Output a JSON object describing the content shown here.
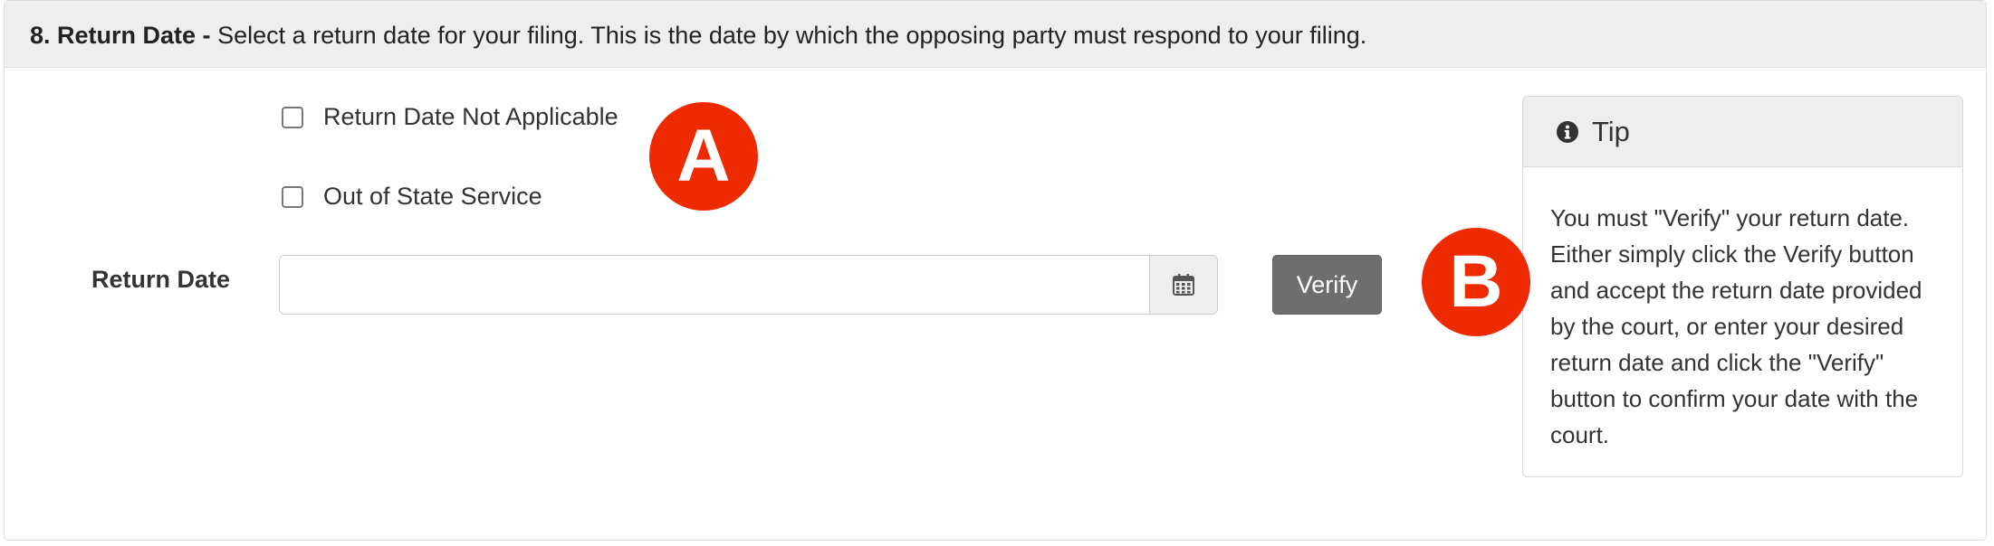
{
  "section": {
    "number_title": "8. Return Date -",
    "description": "Select a return date for your filing. This is the date by which the opposing party must respond to your filing."
  },
  "checkboxes": [
    {
      "label": "Return Date Not Applicable",
      "checked": false
    },
    {
      "label": "Out of State Service",
      "checked": false
    }
  ],
  "return_date": {
    "label": "Return Date",
    "value": "",
    "calendar_icon": "calendar-icon"
  },
  "verify_button": {
    "label": "Verify"
  },
  "tip": {
    "icon": "info-circle-icon",
    "title": "Tip",
    "body": "You must \"Verify\" your return date. Either simply click the Verify button and accept the return date provided by the court, or enter your desired return date and click the \"Verify\" button to confirm your date with the court."
  },
  "markers": {
    "a": "A",
    "b": "B"
  },
  "colors": {
    "heading_bg": "#eeeeee",
    "button_bg": "#6e6e6e",
    "marker": "#ee2a00"
  }
}
